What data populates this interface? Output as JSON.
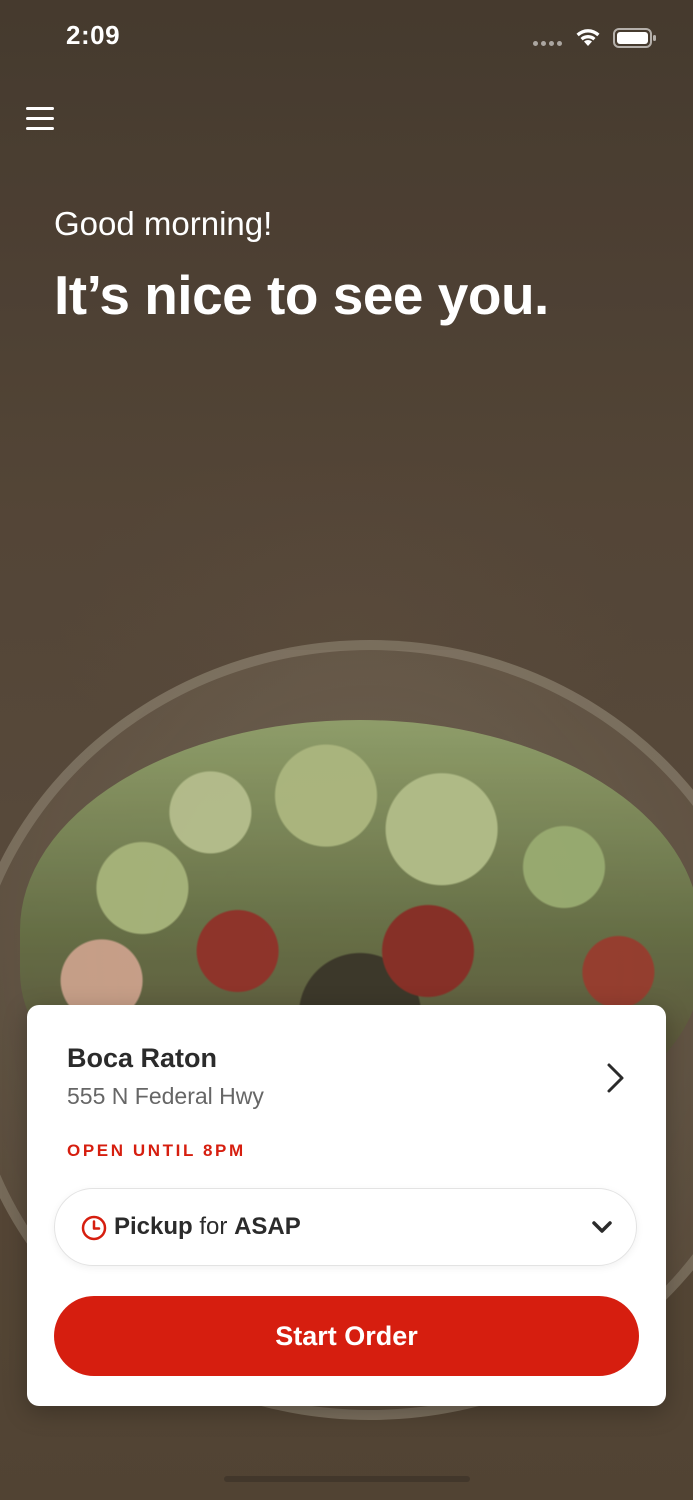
{
  "status_bar": {
    "time": "2:09"
  },
  "header": {
    "menu_icon": "hamburger-menu-icon"
  },
  "greeting": {
    "salutation": "Good morning!",
    "headline": "It’s nice to see you."
  },
  "location_card": {
    "store_name": "Boca Raton",
    "store_address": "555 N Federal Hwy",
    "open_status": "OPEN UNTIL 8PM",
    "order_mode": {
      "method": "Pickup",
      "connector": "for",
      "time": "ASAP"
    },
    "start_order_label": "Start Order"
  },
  "colors": {
    "accent": "#d61e0f",
    "card_background": "#ffffff",
    "text_primary": "#2b2b2b",
    "text_secondary": "#666666"
  }
}
